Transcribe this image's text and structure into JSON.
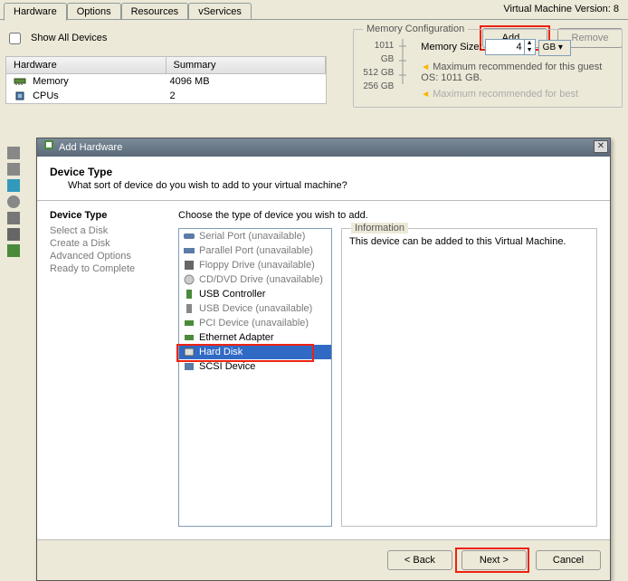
{
  "vm_version": "Virtual Machine Version: 8",
  "tabs": [
    "Hardware",
    "Options",
    "Resources",
    "vServices"
  ],
  "show_all_devices": "Show All Devices",
  "add_button": "Add...",
  "remove_button": "Remove",
  "hw_table": {
    "headers": [
      "Hardware",
      "Summary"
    ],
    "rows": [
      {
        "name": "Memory",
        "summary": "4096 MB"
      },
      {
        "name": "CPUs",
        "summary": "2"
      }
    ]
  },
  "memory": {
    "legend": "Memory Configuration",
    "sizes": [
      "1011 GB",
      "512 GB",
      "256 GB"
    ],
    "label": "Memory Size:",
    "value": "4",
    "unit": "GB",
    "note1": "Maximum recommended for this guest OS: 1011 GB.",
    "note2": "Maximum recommended for best"
  },
  "dialog": {
    "title": "Add Hardware",
    "heading": "Device Type",
    "sub": "What sort of device do you wish to add to your virtual machine?",
    "nav_title": "Device Type",
    "nav_items": [
      "Select a Disk",
      "Create a Disk",
      "Advanced Options",
      "Ready to Complete"
    ],
    "instruction": "Choose the type of device you wish to add.",
    "devices": [
      {
        "label": "Serial Port (unavailable)",
        "avail": false
      },
      {
        "label": "Parallel Port (unavailable)",
        "avail": false
      },
      {
        "label": "Floppy Drive (unavailable)",
        "avail": false
      },
      {
        "label": "CD/DVD Drive (unavailable)",
        "avail": false
      },
      {
        "label": "USB Controller",
        "avail": true
      },
      {
        "label": "USB Device (unavailable)",
        "avail": false
      },
      {
        "label": "PCI Device (unavailable)",
        "avail": false
      },
      {
        "label": "Ethernet Adapter",
        "avail": true
      },
      {
        "label": "Hard Disk",
        "avail": true,
        "selected": true
      },
      {
        "label": "SCSI Device",
        "avail": true
      }
    ],
    "info_legend": "Information",
    "info_text": "This device can be added to this Virtual Machine.",
    "back": "< Back",
    "next": "Next >",
    "cancel": "Cancel"
  }
}
